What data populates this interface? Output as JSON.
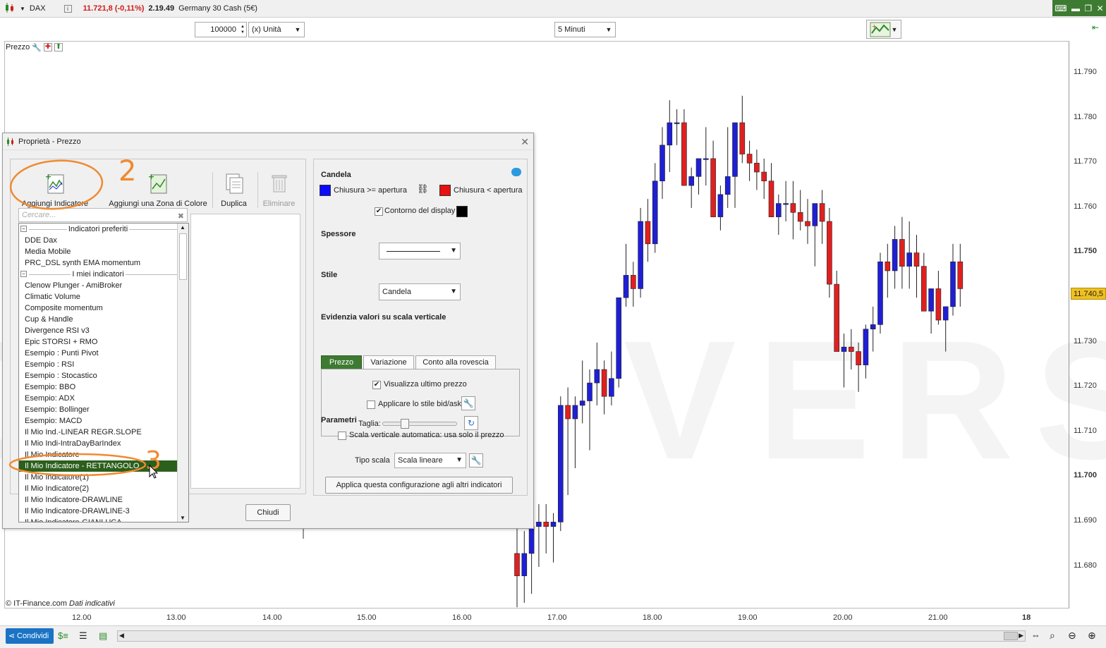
{
  "header": {
    "instrument": "DAX",
    "price": "11.721,8 (-0,11%)",
    "time": "2.19.49",
    "name": "Germany 30 Cash (5€)"
  },
  "toolbar": {
    "quantity": "100000",
    "unit": "(x) Unità",
    "timeframe": "5 Minuti"
  },
  "chart": {
    "panel_label": "Prezzo",
    "y_ticks": [
      "11.790",
      "11.780",
      "11.770",
      "11.760",
      "11.750",
      "11.740",
      "11.730",
      "11.720",
      "11.710",
      "11.700",
      "11.690",
      "11.680"
    ],
    "current_price": "11.740,5",
    "x_ticks": [
      "12.00",
      "13.00",
      "14.00",
      "15.00",
      "16.00",
      "17.00",
      "18.00",
      "19.00",
      "20.00",
      "21.00",
      "18"
    ],
    "footer_source": "© IT-Finance.com",
    "footer_note": "Dati indicativi",
    "watermark": "DEMO VERSION",
    "up_color": "#1f1fd6",
    "down_color": "#e02020"
  },
  "bottom": {
    "share_label": "Condividi"
  },
  "dialog": {
    "title": "Proprietà - Prezzo",
    "toolbar": {
      "add_indicator": "Aggiungi Indicatore",
      "add_zone": "Aggiungi una Zona di Colore",
      "duplicate": "Duplica",
      "delete": "Eliminare"
    },
    "search_placeholder": "Cercare...",
    "groups": {
      "favorites": "Indicatori preferiti",
      "mine": "I miei indicatori"
    },
    "favorites": [
      "DDE  Dax",
      "Media Mobile",
      "PRC_DSL synth EMA momentum"
    ],
    "mine": [
      "Clenow Plunger - AmiBroker",
      "Climatic Volume",
      "Composite momentum",
      "Cup & Handle",
      "Divergence RSI v3",
      "Epic STORSI + RMO",
      "Esempio : Punti Pivot",
      "Esempio : RSI",
      "Esempio : Stocastico",
      "Esempio:  BBO",
      "Esempio: ADX",
      "Esempio: Bollinger",
      "Esempio: MACD",
      "Il Mio Ind.-LINEAR REGR.SLOPE",
      "Il Mio Indi-IntraDayBarIndex",
      "Il Mio Indicatore",
      "Il Mio Indicatore - RETTANGOLO",
      "Il Mio Indicatore(1)",
      "Il Mio Indicatore(2)",
      "Il Mio Indicatore-DRAWLINE",
      "Il Mio Indicatore-DRAWLINE-3",
      "Il Mio Indicatore-GIANLUCA"
    ],
    "selected_index": 16,
    "close_label": "Chiudi",
    "right": {
      "candle_title": "Candela",
      "close_up_label": "Chiusura >= apertura",
      "close_down_label": "Chiusura < apertura",
      "up_color": "#0a0aff",
      "down_color": "#e81010",
      "outline_label": "Contorno del display",
      "outline_checked": true,
      "outline_color": "#000000",
      "thickness_title": "Spessore",
      "style_title": "Stile",
      "style_value": "Candela",
      "highlight_title": "Evidenzia valori su scala verticale",
      "tabs": [
        "Prezzo",
        "Variazione",
        "Conto alla rovescia"
      ],
      "active_tab": 0,
      "show_last_price": "Visualizza ultimo prezzo",
      "show_last_checked": true,
      "bidask_label": "Applicare lo stile bid/ask",
      "bidask_checked": false,
      "size_label": "Taglia:",
      "params_title": "Parametri",
      "autoscale_label": "Scala verticale automatica: usa solo il prezzo",
      "autoscale_checked": false,
      "scale_type_label": "Tipo scala",
      "scale_type_value": "Scala lineare",
      "apply_label": "Applica questa configurazione agli altri indicatori"
    }
  },
  "annotations": [
    "2",
    "3"
  ]
}
